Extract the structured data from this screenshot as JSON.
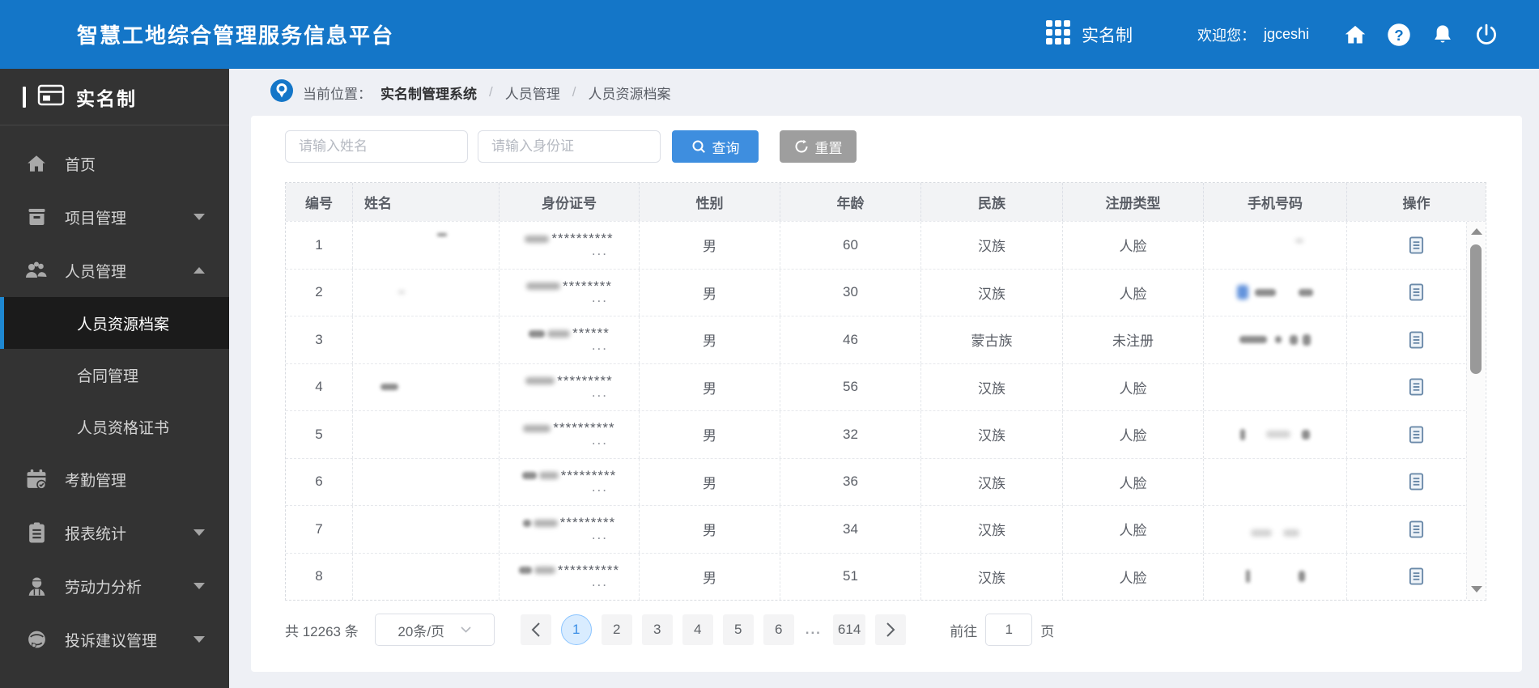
{
  "topbar": {
    "title": "智慧工地综合管理服务信息平台",
    "app_switch_label": "实名制",
    "welcome_label": "欢迎您：",
    "username": "jgceshi"
  },
  "sidebar": {
    "header": "实名制",
    "items": {
      "home": "首页",
      "project": "项目管理",
      "personnel": "人员管理",
      "attendance": "考勤管理",
      "report": "报表统计",
      "labor": "劳动力分析",
      "complaint": "投诉建议管理"
    },
    "submenu": {
      "archive": "人员资源档案",
      "contract": "合同管理",
      "certificate": "人员资格证书"
    }
  },
  "breadcrumb": {
    "prefix": "当前位置：",
    "root": "实名制管理系统",
    "sep": "/",
    "level2": "人员管理",
    "level3": "人员资源档案"
  },
  "filters": {
    "name_placeholder": "请输入姓名",
    "id_placeholder": "请输入身份证",
    "search_label": "查询",
    "reset_label": "重置"
  },
  "table": {
    "headers": [
      "编号",
      "姓名",
      "身份证号",
      "性别",
      "年龄",
      "民族",
      "注册类型",
      "手机号码",
      "操作"
    ],
    "id_ellipsis": "...",
    "rows": [
      {
        "no": "1",
        "id_mask": "**********",
        "gender": "男",
        "age": "60",
        "nation": "汉族",
        "reg": "人脸"
      },
      {
        "no": "2",
        "id_mask": "********",
        "gender": "男",
        "age": "30",
        "nation": "汉族",
        "reg": "人脸"
      },
      {
        "no": "3",
        "id_mask": "******",
        "gender": "男",
        "age": "46",
        "nation": "蒙古族",
        "reg": "未注册"
      },
      {
        "no": "4",
        "id_mask": "*********",
        "gender": "男",
        "age": "56",
        "nation": "汉族",
        "reg": "人脸"
      },
      {
        "no": "5",
        "id_mask": "**********",
        "gender": "男",
        "age": "32",
        "nation": "汉族",
        "reg": "人脸"
      },
      {
        "no": "6",
        "id_mask": "*********",
        "gender": "男",
        "age": "36",
        "nation": "汉族",
        "reg": "人脸"
      },
      {
        "no": "7",
        "id_mask": "*********",
        "gender": "男",
        "age": "34",
        "nation": "汉族",
        "reg": "人脸"
      },
      {
        "no": "8",
        "id_mask": "**********",
        "gender": "男",
        "age": "51",
        "nation": "汉族",
        "reg": "人脸"
      }
    ]
  },
  "pagination": {
    "total": "共 12263 条",
    "page_size": "20条/页",
    "pages": [
      "1",
      "2",
      "3",
      "4",
      "5",
      "6"
    ],
    "ellipsis": "...",
    "last_page": "614",
    "goto_label": "前往",
    "goto_value": "1",
    "goto_unit": "页"
  },
  "colors": {
    "header_blue": "#1476c8",
    "accent_blue": "#3a8ee6",
    "sidebar_dark": "#333333"
  }
}
